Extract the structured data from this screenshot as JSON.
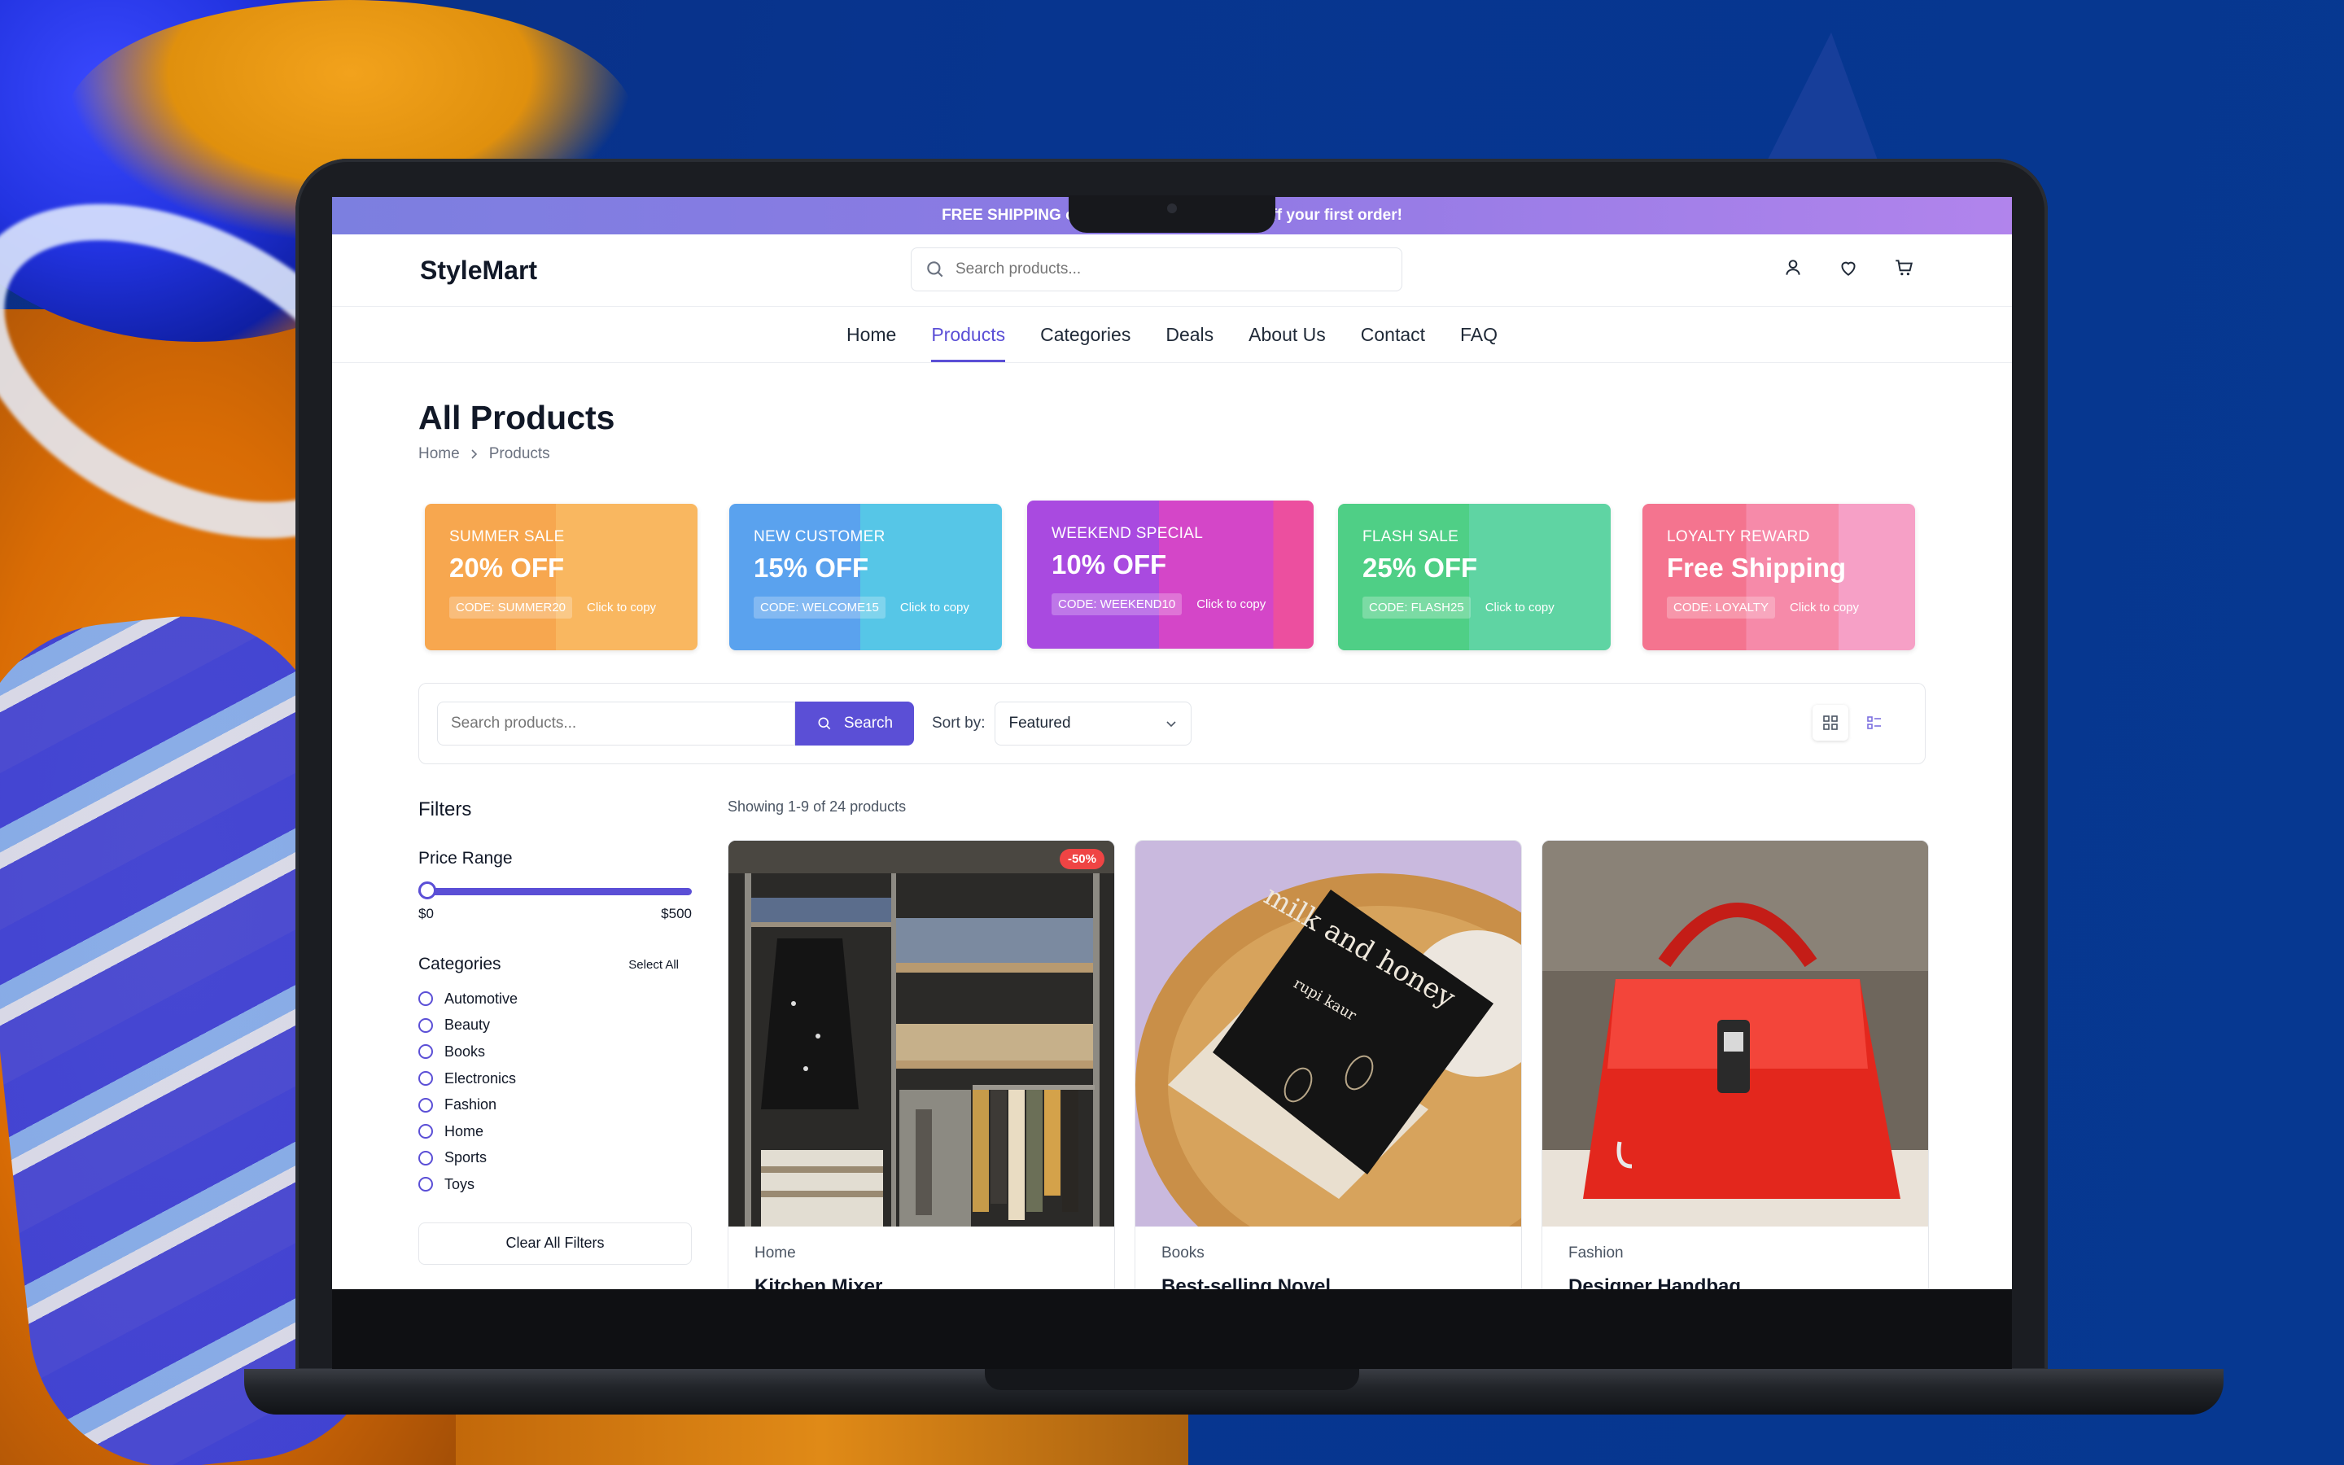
{
  "promo_bar": {
    "text": "FREE SHIPPING on orders o… E10 for 10% off your first order!"
  },
  "header": {
    "logo": "StyleMart",
    "search_placeholder": "Search products..."
  },
  "nav": [
    {
      "label": "Home",
      "active": false
    },
    {
      "label": "Products",
      "active": true
    },
    {
      "label": "Categories",
      "active": false
    },
    {
      "label": "Deals",
      "active": false
    },
    {
      "label": "About Us",
      "active": false
    },
    {
      "label": "Contact",
      "active": false
    },
    {
      "label": "FAQ",
      "active": false
    }
  ],
  "page": {
    "title": "All Products",
    "breadcrumb": [
      "Home",
      "Products"
    ]
  },
  "promos": [
    {
      "label": "SUMMER SALE",
      "discount": "20% OFF",
      "code": "CODE: SUMMER20",
      "action": "Click to copy",
      "color": "#f7a74f",
      "color2": "#f9b760"
    },
    {
      "label": "NEW CUSTOMER",
      "discount": "15% OFF",
      "code": "CODE: WELCOME15",
      "action": "Click to copy",
      "color": "#5aa2ee",
      "color2": "#56c6e7"
    },
    {
      "label": "WEEKEND SPECIAL",
      "discount": "10% OFF",
      "code": "CODE: WEEKEND10",
      "action": "Click to copy",
      "color": "#b244dd",
      "color2": "#ec4f9f"
    },
    {
      "label": "FLASH SALE",
      "discount": "25% OFF",
      "code": "CODE: FLASH25",
      "action": "Click to copy",
      "color": "#4fcf86",
      "color2": "#5fd4a3"
    },
    {
      "label": "LOYALTY REWARD",
      "discount": "Free Shipping",
      "code": "CODE: LOYALTY",
      "action": "Click to copy",
      "color": "#f4748f",
      "color2": "#f6a0c6"
    }
  ],
  "toolbar": {
    "search_placeholder": "Search products...",
    "search_button": "Search",
    "sort_label": "Sort by:",
    "sort_value": "Featured"
  },
  "filters": {
    "title": "Filters",
    "price_label": "Price Range",
    "price_min": "$0",
    "price_max": "$500",
    "categories_label": "Categories",
    "select_all": "Select All",
    "categories": [
      "Automotive",
      "Beauty",
      "Books",
      "Electronics",
      "Fashion",
      "Home",
      "Sports",
      "Toys"
    ],
    "clear_button": "Clear All Filters"
  },
  "results": {
    "showing": "Showing 1-9 of 24 products"
  },
  "products": [
    {
      "category": "Home",
      "name": "Kitchen Mixer",
      "badge": "-50%",
      "image": "clothing-rack-photo"
    },
    {
      "category": "Books",
      "name": "Best-selling Novel",
      "badge": "",
      "image": "book-milk-and-honey-photo",
      "book_title": "milk and honey",
      "book_author": "rupi kaur"
    },
    {
      "category": "Fashion",
      "name": "Designer Handbag",
      "badge": "",
      "image": "red-handbag-photo"
    }
  ],
  "colors": {
    "accent": "#5b4fd6",
    "badge": "#ef4444"
  }
}
